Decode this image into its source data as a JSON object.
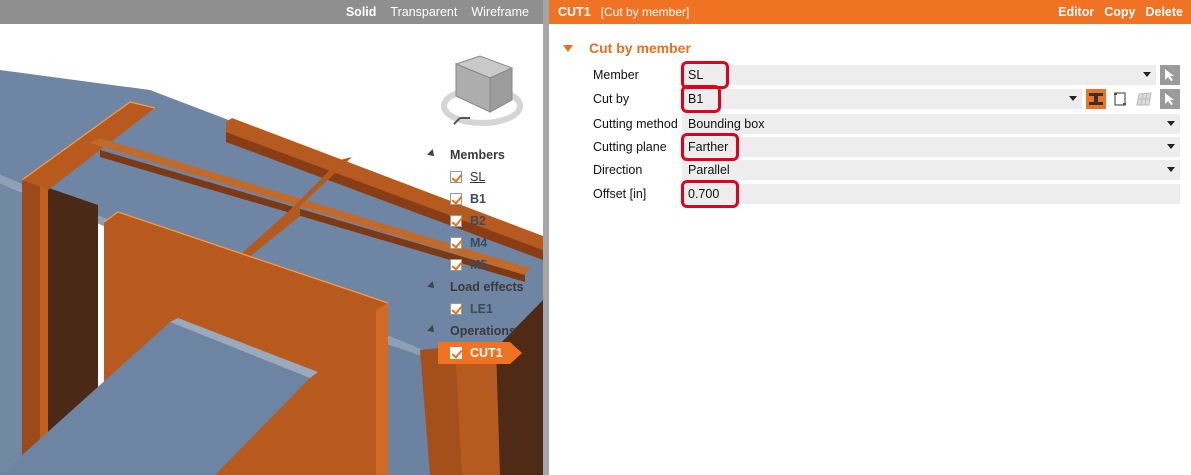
{
  "viewport": {
    "toolbar": {
      "solid": "Solid",
      "transparent": "Transparent",
      "wireframe": "Wireframe"
    }
  },
  "tree": {
    "members_label": "Members",
    "members": [
      "SL",
      "B1",
      "B2",
      "M4",
      "M5"
    ],
    "load_effects_label": "Load effects",
    "load_effects": [
      "LE1"
    ],
    "operations_label": "Operations",
    "operations": [
      "CUT1"
    ]
  },
  "panel": {
    "title": "CUT1",
    "subtitle": "[Cut by member]",
    "actions": {
      "editor": "Editor",
      "copy": "Copy",
      "delete": "Delete"
    },
    "section_title": "Cut by member",
    "fields": {
      "member": {
        "label": "Member",
        "value": "SL"
      },
      "cut_by": {
        "label": "Cut by",
        "value": "B1"
      },
      "cutting_method": {
        "label": "Cutting method",
        "value": "Bounding box"
      },
      "cutting_plane": {
        "label": "Cutting plane",
        "value": "Farther"
      },
      "direction": {
        "label": "Direction",
        "value": "Parallel"
      },
      "offset": {
        "label": "Offset [in]",
        "value": "0.700"
      }
    }
  },
  "colors": {
    "accent": "#f07323",
    "steel": "#b5571f",
    "plate": "#6f86a2",
    "highlight": "#e0001b"
  }
}
